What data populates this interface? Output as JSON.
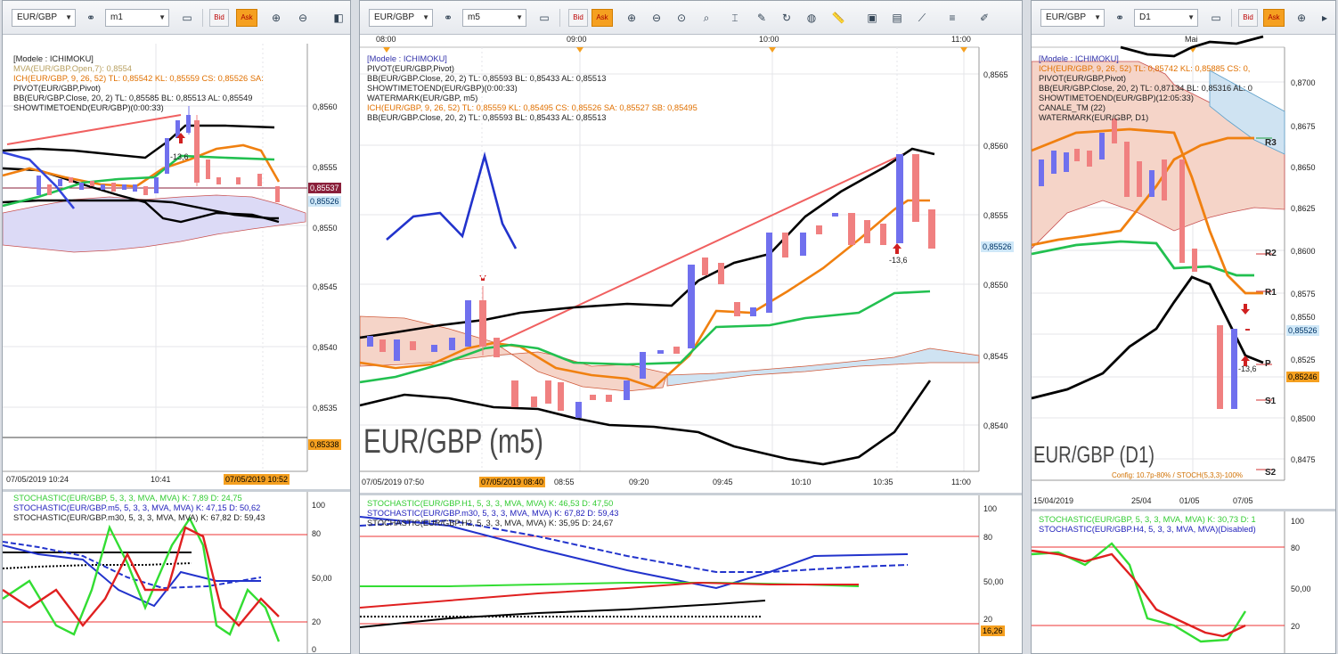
{
  "colors": {
    "up": "#7070ee",
    "down": "#f08080",
    "accent": "#f5a020",
    "ichimoku_cloud": "#f5d4c8",
    "cloud_blue": "#cfe3f2"
  },
  "panels": [
    {
      "id": "m1",
      "toolbar": {
        "symbol": "EUR/GBP",
        "timeframe": "m1",
        "bid_label": "Bid",
        "ask_label": "Ask"
      },
      "legend": [
        {
          "text": "[Modele : ICHIMOKU]",
          "color": "#3333aa"
        },
        {
          "text": "MVA(EUR/GBP.Open,7): 0,8554",
          "color": "#b8a060"
        },
        {
          "text": "ICH(EUR/GBP, 9, 26, 52)  TL: 0,85542  KL: 0,85559  CS: 0,85526  SA:",
          "color": "#e07000"
        },
        {
          "text": "PIVOT(EUR/GBP,Pivot)",
          "color": "#111"
        },
        {
          "text": "BB(EUR/GBP.Close, 20, 2)  TL: 0,85585  BL: 0,85513  AL: 0,85549",
          "color": "#111"
        },
        {
          "text": "SHOWTIMETOEND(EUR/GBP)(0:00:33)",
          "color": "#111"
        }
      ],
      "y_axis": [
        "0,8560",
        "0,8555",
        "0,8550",
        "0,8545",
        "0,8540",
        "0,8535"
      ],
      "price_tags": [
        {
          "text": "0,85537",
          "bg": "#8a1f3a",
          "fg": "#fff"
        },
        {
          "text": "0,85526",
          "bg": "#cfe8f8",
          "fg": "#036"
        },
        {
          "text": "0,85338",
          "bg": "#f5a020",
          "fg": "#000"
        }
      ],
      "x_axis": [
        "07/05/2019 10:24",
        "10:41"
      ],
      "time_highlight": "07/05/2019 10:52",
      "annotation": "-13,6",
      "stoch_legend": [
        {
          "text": "STOCHASTIC(EUR/GBP, 5, 3, 3, MVA, MVA)  K: 7,89  D: 24,75",
          "color": "#33cc33"
        },
        {
          "text": "STOCHASTIC(EUR/GBP.m5, 5, 3, 3, MVA, MVA)  K: 47,15  D: 50,62",
          "color": "#2222bb"
        },
        {
          "text": "STOCHASTIC(EUR/GBP.m30, 5, 3, 3, MVA, MVA)  K: 67,82  D: 59,43",
          "color": "#111"
        }
      ],
      "stoch_axis": [
        "100",
        "80",
        "50,00",
        "20",
        "0"
      ]
    },
    {
      "id": "m5",
      "toolbar": {
        "symbol": "EUR/GBP",
        "timeframe": "m5",
        "bid_label": "Bid",
        "ask_label": "Ask"
      },
      "top_axis": [
        "08:00",
        "09:00",
        "10:00",
        "11:00"
      ],
      "legend": [
        {
          "text": "[Modele : ICHIMOKU]",
          "color": "#3333aa"
        },
        {
          "text": "PIVOT(EUR/GBP,Pivot)",
          "color": "#111"
        },
        {
          "text": "BB(EUR/GBP.Close, 20, 2)  TL: 0,85593  BL: 0,85433  AL: 0,85513",
          "color": "#111"
        },
        {
          "text": "SHOWTIMETOEND(EUR/GBP)(0:00:33)",
          "color": "#111"
        },
        {
          "text": "WATERMARK(EUR/GBP, m5)",
          "color": "#111"
        },
        {
          "text": "ICH(EUR/GBP, 9, 26, 52)  TL: 0,85559  KL: 0,85495  CS: 0,85526  SA: 0,85527  SB: 0,85495",
          "color": "#e07000"
        },
        {
          "text": "BB(EUR/GBP.Close, 20, 2)  TL: 0,85593  BL: 0,85433  AL: 0,85513",
          "color": "#111"
        }
      ],
      "y_axis": [
        "0,8565",
        "0,8560",
        "0,8555",
        "0,8550",
        "0,8545",
        "0,8540"
      ],
      "price_tags": [
        {
          "text": "0,85526",
          "bg": "#cfe8f8",
          "fg": "#036"
        }
      ],
      "watermark": "EUR/GBP (m5)",
      "x_axis": [
        "07/05/2019 07:50",
        "08:55",
        "09:20",
        "09:45",
        "10:10",
        "10:35",
        "11:00"
      ],
      "time_highlight": "07/05/2019 08:40",
      "annotation": "-13,6",
      "stoch_legend": [
        {
          "text": "STOCHASTIC(EUR/GBP.H1, 5, 3, 3, MVA, MVA)  K: 46,53  D: 47,50",
          "color": "#33cc33"
        },
        {
          "text": "STOCHASTIC(EUR/GBP.m30, 5, 3, 3, MVA, MVA)  K: 67,82  D: 59,43",
          "color": "#2222bb"
        },
        {
          "text": "STOCHASTIC(EUR/GBP.H2, 5, 3, 3, MVA, MVA)  K: 35,95  D: 24,67",
          "color": "#111"
        }
      ],
      "stoch_axis": [
        "100",
        "80",
        "50,00",
        "20"
      ],
      "stoch_tag": "16,26"
    },
    {
      "id": "d1",
      "toolbar": {
        "symbol": "EUR/GBP",
        "timeframe": "D1",
        "bid_label": "Bid",
        "ask_label": "Ask"
      },
      "top_axis": [
        "Mai"
      ],
      "legend": [
        {
          "text": "[Modele : ICHIMOKU]",
          "color": "#3333aa"
        },
        {
          "text": "ICH(EUR/GBP, 9, 26, 52)  TL: 0,85742  KL: 0,85885  CS: 0,",
          "color": "#e07000"
        },
        {
          "text": "PIVOT(EUR/GBP,Pivot)",
          "color": "#111"
        },
        {
          "text": "BB(EUR/GBP.Close, 20, 2)  TL: 0,87134  BL: 0,85316  AL: 0",
          "color": "#111"
        },
        {
          "text": "SHOWTIMETOEND(EUR/GBP)(12:05:33)",
          "color": "#111"
        },
        {
          "text": "CANALE_TM (22)",
          "color": "#111"
        },
        {
          "text": "WATERMARK(EUR/GBP, D1)",
          "color": "#111"
        }
      ],
      "y_axis": [
        "0,8700",
        "0,8675",
        "0,8650",
        "0,8625",
        "0,8600",
        "0,8575",
        "0,8550",
        "0,8525",
        "0,8500",
        "0,8475"
      ],
      "price_tags": [
        {
          "text": "0,85526",
          "bg": "#cfe8f8",
          "fg": "#036"
        },
        {
          "text": "0,85246",
          "bg": "#f5a020",
          "fg": "#000"
        }
      ],
      "pivot_levels": [
        "R3",
        "R2",
        "R1",
        "P",
        "S1",
        "S2"
      ],
      "watermark": "EUR/GBP (D1)",
      "config_note": "Config: 10.7p-80% / STOCH(5,3,3)-100%",
      "x_axis": [
        "15/04/2019",
        "25/04",
        "01/05",
        "07/05"
      ],
      "annotation": "-13,6",
      "stoch_legend": [
        {
          "text": "STOCHASTIC(EUR/GBP, 5, 3, 3, MVA, MVA)  K: 30,73  D: 1",
          "color": "#33cc33"
        },
        {
          "text": "STOCHASTIC(EUR/GBP.H4, 5, 3, 3, MVA, MVA)(Disabled)",
          "color": "#2222bb"
        }
      ],
      "stoch_axis": [
        "100",
        "80",
        "50,00",
        "20"
      ]
    }
  ]
}
